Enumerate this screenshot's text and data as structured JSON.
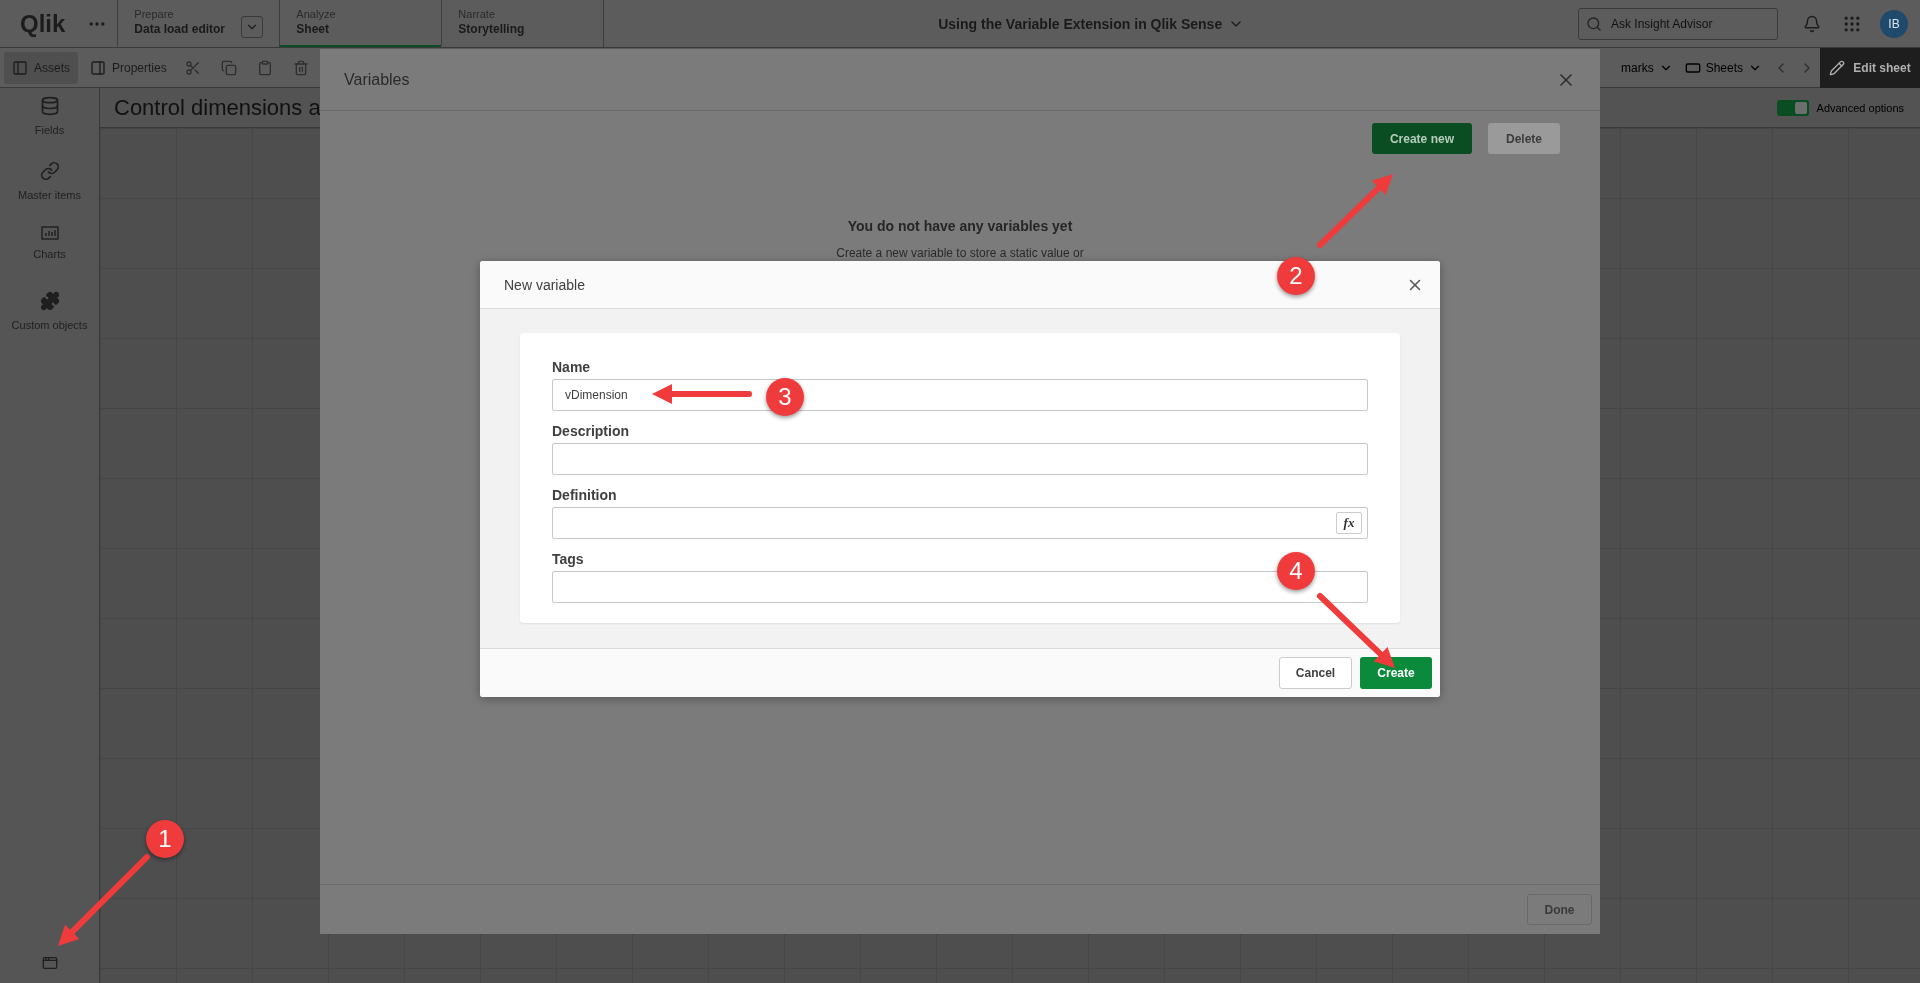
{
  "app_bar": {
    "logo": "Qlik",
    "tabs": [
      {
        "section": "Prepare",
        "label": "Data load editor",
        "selected": false,
        "has_dropdown": true
      },
      {
        "section": "Analyze",
        "label": "Sheet",
        "selected": true,
        "has_dropdown": false
      },
      {
        "section": "Narrate",
        "label": "Storytelling",
        "selected": false,
        "has_dropdown": false
      }
    ],
    "app_title": "Using the Variable Extension in Qlik Sense",
    "search": {
      "placeholder": "Ask Insight Advisor"
    },
    "avatar": "IB"
  },
  "toolbar": {
    "panels": [
      {
        "label": "Assets",
        "kind": "left"
      },
      {
        "label": "Properties",
        "kind": "right"
      }
    ],
    "bookmarks": "marks",
    "sheets": "Sheets",
    "edit": "Edit sheet"
  },
  "sidebar": {
    "items": [
      {
        "label": "Fields",
        "kind": "fields"
      },
      {
        "label": "Master items",
        "kind": "master"
      },
      {
        "label": "Charts",
        "kind": "charts"
      },
      {
        "label": "Custom objects",
        "kind": "custom"
      }
    ]
  },
  "sheet": {
    "title": "Control dimensions a",
    "advanced_options": {
      "label": "Advanced options",
      "on": true
    }
  },
  "variables_dialog": {
    "title": "Variables",
    "buttons": [
      {
        "label": "Create new",
        "kind": "primary",
        "disabled": false
      },
      {
        "label": "Delete",
        "kind": "secondary",
        "disabled": true
      }
    ],
    "empty_title": "You do not have any variables yet",
    "empty_text": "Create a new variable to store a static value or",
    "done": "Done"
  },
  "new_variable_dialog": {
    "title": "New variable",
    "fields": [
      {
        "label": "Name",
        "value": "vDimension"
      },
      {
        "label": "Description"
      },
      {
        "label": "Definition",
        "expression_button": "fx"
      },
      {
        "label": "Tags"
      }
    ],
    "cancel": "Cancel",
    "create": "Create"
  },
  "annotations": [
    {
      "number": "1"
    },
    {
      "number": "2"
    },
    {
      "number": "3"
    },
    {
      "number": "4"
    }
  ]
}
